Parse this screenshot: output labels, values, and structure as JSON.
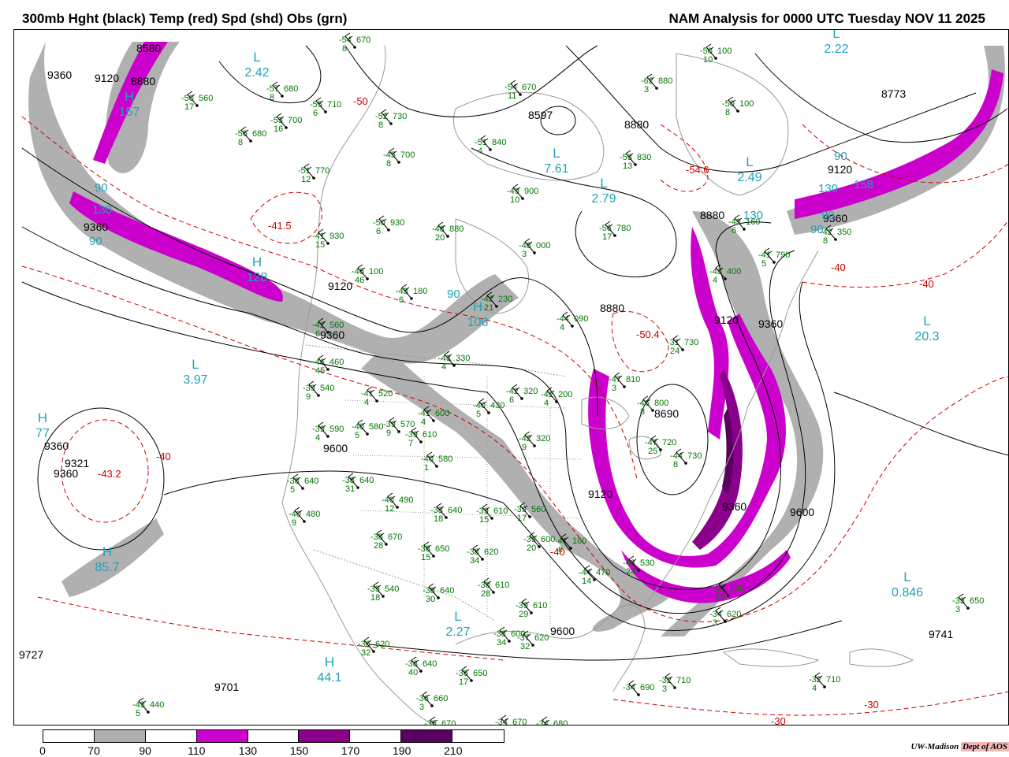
{
  "header": {
    "title_left": "300mb Hght (black) Temp (red) Spd (shd) Obs (grn)",
    "title_right": "NAM Analysis for 0000 UTC Tuesday  NOV 11 2025"
  },
  "colors": {
    "height_contour": "#000000",
    "temp_contour": "#cc0000",
    "obs": "#007700",
    "centers": "#1fa3b8",
    "map_lines": "#9a9a9a",
    "speed_70_90": "#b0b0b0",
    "speed_110_130": "#cc00cc",
    "speed_150_170": "#8a008a",
    "speed_190_210": "#5a0060"
  },
  "legend": {
    "ticks": [
      "0",
      "70",
      "90",
      "110",
      "130",
      "150",
      "170",
      "190",
      "210"
    ],
    "segment_colors": [
      "#ffffff",
      "#b0b0b0",
      "#ffffff",
      "#cc00cc",
      "#ffffff",
      "#8a008a",
      "#ffffff",
      "#5a0060",
      "#ffffff"
    ]
  },
  "credit": {
    "org": "UW-Madison",
    "dept": "Dept of AOS"
  },
  "height_labels": [
    "9360",
    "9120",
    "8880",
    "8580",
    "8773",
    "8597",
    "8880",
    "9120",
    "9360",
    "9360",
    "8880",
    "9120",
    "9360",
    "8880",
    "9120",
    "9360",
    "9600",
    "9360",
    "9321",
    "9360",
    "9120",
    "8690",
    "9360",
    "9600",
    "9600",
    "9741",
    "9701",
    "9727"
  ],
  "temp_labels": [
    "-41.5",
    "-54.6",
    "-50.4",
    "-43.2",
    "-40",
    "-40",
    "-40",
    "-40",
    "-30",
    "-30",
    "-50"
  ],
  "centers": [
    {
      "letter": "L",
      "value": "2.42"
    },
    {
      "letter": "H",
      "value": "157"
    },
    {
      "letter": "L",
      "value": "7.61"
    },
    {
      "letter": "L",
      "value": "2.79"
    },
    {
      "letter": "L",
      "value": "2.49"
    },
    {
      "letter": "L",
      "value": "2.22"
    },
    {
      "letter": "H",
      "value": "128"
    },
    {
      "letter": "H",
      "value": "106"
    },
    {
      "letter": "L",
      "value": "3.97"
    },
    {
      "letter": "L",
      "value": "20.3"
    },
    {
      "letter": "H",
      "value": "85.7"
    },
    {
      "letter": "L",
      "value": "2.27"
    },
    {
      "letter": "H",
      "value": "44.1"
    },
    {
      "letter": "L",
      "value": "0.846"
    },
    {
      "letter": "H",
      "value": "77"
    }
  ],
  "speed_labels": [
    "90",
    "130",
    "90",
    "90",
    "158",
    "130",
    "90",
    "90",
    "90",
    "130"
  ],
  "observations": [
    {
      "t": "-54",
      "h": "670",
      "d": "8"
    },
    {
      "t": "-50",
      "h": "560",
      "d": "17"
    },
    {
      "t": "-57",
      "h": "680",
      "d": "8"
    },
    {
      "t": "-55",
      "h": "710",
      "d": "6"
    },
    {
      "t": "-53",
      "h": "700",
      "d": "16"
    },
    {
      "t": "-56",
      "h": "680",
      "d": "8"
    },
    {
      "t": "-52",
      "h": "730",
      "d": "8"
    },
    {
      "t": "-54",
      "h": "670",
      "d": "11"
    },
    {
      "t": "-51",
      "h": "840",
      "d": "4"
    },
    {
      "t": "-45",
      "h": "700",
      "d": "8"
    },
    {
      "t": "-51",
      "h": "770",
      "d": "12"
    },
    {
      "t": "-50",
      "h": "100",
      "d": "10"
    },
    {
      "t": "-62",
      "h": "880",
      "d": "3"
    },
    {
      "t": "-50",
      "h": "100",
      "d": "8"
    },
    {
      "t": "-53",
      "h": "830",
      "d": "13"
    },
    {
      "t": "-49",
      "h": "900",
      "d": "10"
    },
    {
      "t": "-50",
      "h": "930",
      "d": "6"
    },
    {
      "t": "-48",
      "h": "880",
      "d": "20"
    },
    {
      "t": "-48",
      "h": "000",
      "d": "3"
    },
    {
      "t": "-56",
      "h": "780",
      "d": "17"
    },
    {
      "t": "-41",
      "h": "930",
      "d": "15"
    },
    {
      "t": "-46",
      "h": "100",
      "d": "46"
    },
    {
      "t": "-43",
      "h": "180",
      "d": "6"
    },
    {
      "t": "-42",
      "h": "230",
      "d": "21"
    },
    {
      "t": "-44",
      "h": "090",
      "d": "4"
    },
    {
      "t": "-42",
      "h": "560",
      "d": "6"
    },
    {
      "t": "-46",
      "h": "460",
      "d": "45"
    },
    {
      "t": "-43",
      "h": "330",
      "d": "4"
    },
    {
      "t": "-39",
      "h": "540",
      "d": "9"
    },
    {
      "t": "-41",
      "h": "520",
      "d": "4"
    },
    {
      "t": "-41",
      "h": "600",
      "d": "4"
    },
    {
      "t": "-40",
      "h": "430",
      "d": "5"
    },
    {
      "t": "-42",
      "h": "320",
      "d": "6"
    },
    {
      "t": "-42",
      "h": "200",
      "d": "4"
    },
    {
      "t": "-39",
      "h": "590",
      "d": "4"
    },
    {
      "t": "-40",
      "h": "580",
      "d": "5"
    },
    {
      "t": "-39",
      "h": "570",
      "d": "9"
    },
    {
      "t": "-39",
      "h": "610",
      "d": "7"
    },
    {
      "t": "-40",
      "h": "580",
      "d": "1"
    },
    {
      "t": "-42",
      "h": "320",
      "d": "9"
    },
    {
      "t": "-38",
      "h": "640",
      "d": "5"
    },
    {
      "t": "-38",
      "h": "640",
      "d": "31"
    },
    {
      "t": "-40",
      "h": "490",
      "d": "12"
    },
    {
      "t": "-38",
      "h": "640",
      "d": "18"
    },
    {
      "t": "-39",
      "h": "610",
      "d": "15"
    },
    {
      "t": "-39",
      "h": "560",
      "d": "17"
    },
    {
      "t": "-40",
      "h": "480",
      "d": "9"
    },
    {
      "t": "-38",
      "h": "670",
      "d": "28"
    },
    {
      "t": "-38",
      "h": "650",
      "d": "15"
    },
    {
      "t": "-38",
      "h": "620",
      "d": "34"
    },
    {
      "t": "-39",
      "h": "600",
      "d": "20"
    },
    {
      "t": "-39",
      "h": "540",
      "d": "18"
    },
    {
      "t": "-38",
      "h": "640",
      "d": "30"
    },
    {
      "t": "-38",
      "h": "610",
      "d": "28"
    },
    {
      "t": "-39",
      "h": "610",
      "d": "29"
    },
    {
      "t": "-38",
      "h": "600",
      "d": "34"
    },
    {
      "t": "-37",
      "h": "620",
      "d": "32"
    },
    {
      "t": "-36",
      "h": "620",
      "d": "32"
    },
    {
      "t": "-38",
      "h": "640",
      "d": "40"
    },
    {
      "t": "-36",
      "h": "650",
      "d": "17"
    },
    {
      "t": "-36",
      "h": "660",
      "d": "3"
    },
    {
      "t": "-35",
      "h": "670",
      "d": "4"
    },
    {
      "t": "-34",
      "h": "670",
      "d": ""
    },
    {
      "t": "-34",
      "h": "680",
      "d": ""
    },
    {
      "t": "-34",
      "h": "690",
      "d": ""
    },
    {
      "t": "-32",
      "h": "710",
      "d": "3"
    },
    {
      "t": "-32",
      "h": "710",
      "d": "4"
    },
    {
      "t": "-30",
      "h": "730",
      "d": "16"
    },
    {
      "t": "-34",
      "h": "620",
      "d": "3"
    },
    {
      "t": "-33",
      "h": "650",
      "d": "3"
    },
    {
      "t": "-31",
      "h": "730",
      "d": "24"
    },
    {
      "t": "-47",
      "h": "810",
      "d": "3"
    },
    {
      "t": "-46",
      "h": "800",
      "d": "8"
    },
    {
      "t": "-47",
      "h": "720",
      "d": "25"
    },
    {
      "t": "-44",
      "h": "730",
      "d": "8"
    },
    {
      "t": "-41",
      "h": "790",
      "d": "5"
    },
    {
      "t": "-42",
      "h": "350",
      "d": "8"
    },
    {
      "t": "-43",
      "h": "400",
      "d": "4"
    },
    {
      "t": "-43",
      "h": "160",
      "d": "6"
    },
    {
      "t": "-41",
      "h": "180",
      "d": "8"
    },
    {
      "t": "-44",
      "h": "470",
      "d": "14"
    },
    {
      "t": "-43",
      "h": "530",
      "d": "24"
    },
    {
      "t": "-43",
      "h": "440",
      "d": "5"
    }
  ]
}
